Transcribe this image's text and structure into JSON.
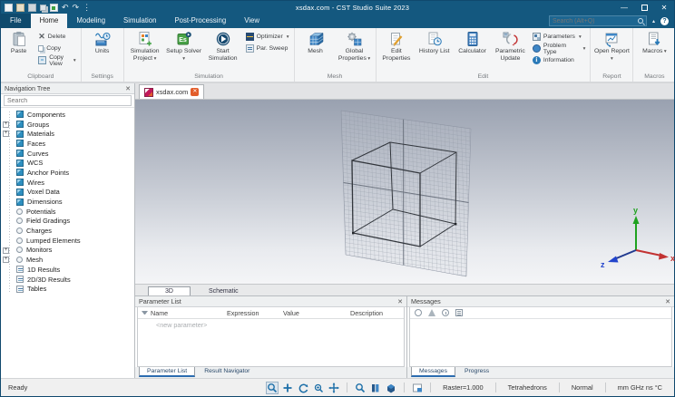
{
  "window": {
    "title": "xsdax.com - CST Studio Suite 2023",
    "search_placeholder": "Search (Alt+Q)"
  },
  "colors": {
    "titlebar_blue": "#14587F",
    "accent_blue": "#1d6fa8",
    "solver_green": "#49a347",
    "tab_close_orange": "#e25d2b",
    "axis_x_red": "#c23232",
    "axis_y_green": "#1fa21f",
    "axis_z_blue": "#2244cc"
  },
  "ribbon": {
    "tabs": [
      "File",
      "Home",
      "Modeling",
      "Simulation",
      "Post-Processing",
      "View"
    ],
    "active_tab": "Home",
    "groups": {
      "clipboard": {
        "label": "Clipboard",
        "paste": "Paste",
        "delete": "Delete",
        "copy": "Copy",
        "copy_view": "Copy View"
      },
      "settings": {
        "label": "Settings",
        "units": "Units"
      },
      "simulation": {
        "label": "Simulation",
        "simulation_project": "Simulation Project",
        "setup_solver": "Setup Solver",
        "start_simulation": "Start Simulation",
        "optimizer": "Optimizer",
        "par_sweep": "Par. Sweep"
      },
      "mesh": {
        "label": "Mesh",
        "mesh": "Mesh",
        "global_properties": "Global Properties"
      },
      "edit": {
        "label": "Edit",
        "edit_properties": "Edit Properties",
        "history_list": "History List",
        "calculator": "Calculator",
        "parametric_update": "Parametric Update",
        "parameters": "Parameters",
        "problem_type": "Problem Type",
        "information": "Information"
      },
      "report": {
        "label": "Report",
        "open_report": "Open Report"
      },
      "macros": {
        "label": "Macros",
        "macros": "Macros"
      }
    }
  },
  "nav_tree": {
    "title": "Navigation Tree",
    "search_placeholder": "Search",
    "items": [
      {
        "label": "Components",
        "icon": "cube-icon",
        "expandable": false
      },
      {
        "label": "Groups",
        "icon": "cube-icon",
        "expandable": true
      },
      {
        "label": "Materials",
        "icon": "cube-icon",
        "expandable": true
      },
      {
        "label": "Faces",
        "icon": "cube-icon",
        "expandable": false
      },
      {
        "label": "Curves",
        "icon": "cube-icon",
        "expandable": false
      },
      {
        "label": "WCS",
        "icon": "cube-icon",
        "expandable": false
      },
      {
        "label": "Anchor Points",
        "icon": "cube-icon",
        "expandable": false
      },
      {
        "label": "Wires",
        "icon": "cube-icon",
        "expandable": false
      },
      {
        "label": "Voxel Data",
        "icon": "cube-icon",
        "expandable": false
      },
      {
        "label": "Dimensions",
        "icon": "cube-icon",
        "expandable": false
      },
      {
        "label": "Potentials",
        "icon": "circle-icon",
        "expandable": false
      },
      {
        "label": "Field Gradings",
        "icon": "circle-icon",
        "expandable": false
      },
      {
        "label": "Charges",
        "icon": "circle-icon",
        "expandable": false
      },
      {
        "label": "Lumped Elements",
        "icon": "circle-icon",
        "expandable": false
      },
      {
        "label": "Monitors",
        "icon": "circle-icon",
        "expandable": true
      },
      {
        "label": "Mesh",
        "icon": "circle-icon",
        "expandable": true
      },
      {
        "label": "1D Results",
        "icon": "chart-icon",
        "expandable": false
      },
      {
        "label": "2D/3D Results",
        "icon": "chart-icon",
        "expandable": false
      },
      {
        "label": "Tables",
        "icon": "chart-icon",
        "expandable": false
      }
    ]
  },
  "document": {
    "tab": "xsdax.com"
  },
  "viewport": {
    "axes": {
      "x": "x",
      "y": "y",
      "z": "z"
    }
  },
  "view_tabs": {
    "d3": "3D",
    "schematic": "Schematic",
    "active": "3D"
  },
  "parameter_list": {
    "title": "Parameter List",
    "columns": [
      "Name",
      "Expression",
      "Value",
      "Description"
    ],
    "new_row": "<new parameter>",
    "tabs": [
      "Parameter List",
      "Result Navigator"
    ],
    "active_tab": "Parameter List"
  },
  "messages": {
    "title": "Messages",
    "tabs": [
      "Messages",
      "Progress"
    ],
    "active_tab": "Messages"
  },
  "status_bar": {
    "ready": "Ready",
    "raster": "Raster=1.000",
    "mesh": "Tetrahedrons",
    "quality": "Normal",
    "units": "mm GHz ns °C"
  }
}
